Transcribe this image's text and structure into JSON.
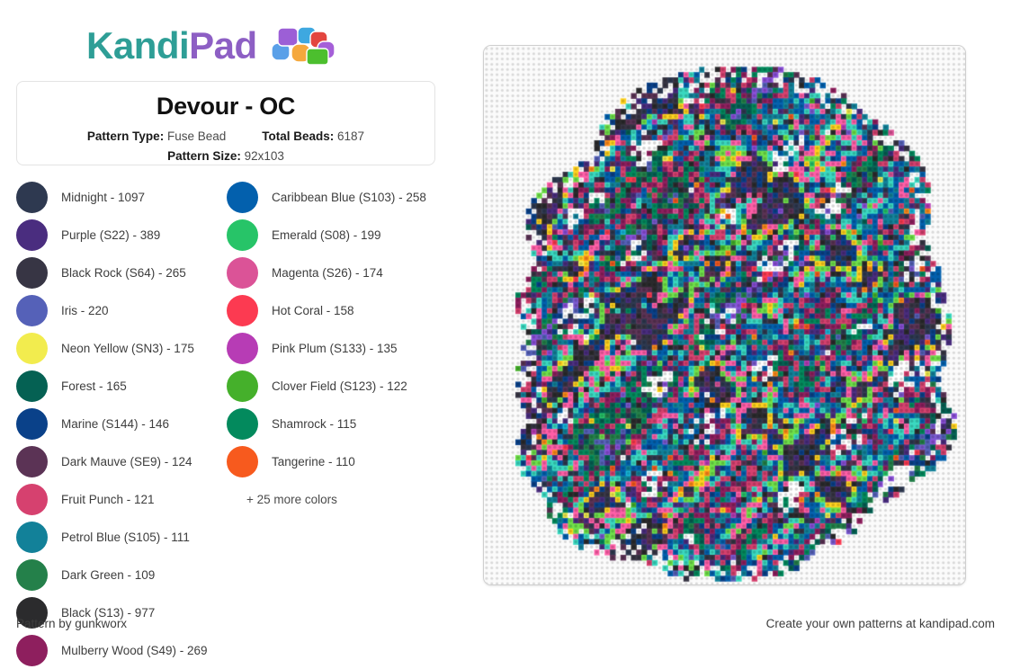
{
  "brand": {
    "name_part1": "Kandi",
    "name_part2": "Pad",
    "color_teal": "#2E9E96",
    "color_purple": "#8D5FC4",
    "bead_icon": "bead-cluster-icon"
  },
  "title_card": {
    "title": "Devour - OC",
    "pattern_type_label": "Pattern Type:",
    "pattern_type_value": "Fuse Bead",
    "total_beads_label": "Total Beads:",
    "total_beads_value": "6187",
    "pattern_size_label": "Pattern Size:",
    "pattern_size_value": "92x103"
  },
  "legend": {
    "more_colors_text": "+ 25 more colors",
    "items": [
      {
        "name": "Midnight - 1097",
        "color": "#2e3950"
      },
      {
        "name": "Purple (S22) - 389",
        "color": "#4a2d7f"
      },
      {
        "name": "Black Rock (S64) - 265",
        "color": "#373544"
      },
      {
        "name": "Iris - 220",
        "color": "#5561b8"
      },
      {
        "name": "Neon Yellow (SN3) - 175",
        "color": "#f2ec4e"
      },
      {
        "name": "Forest - 165",
        "color": "#056153"
      },
      {
        "name": "Marine (S144) - 146",
        "color": "#0a4189"
      },
      {
        "name": "Dark Mauve (SE9) - 124",
        "color": "#5b3355"
      },
      {
        "name": "Fruit Punch - 121",
        "color": "#d6416f"
      },
      {
        "name": "Petrol Blue (S105) - 111",
        "color": "#128199"
      },
      {
        "name": "Dark Green - 109",
        "color": "#24804a"
      },
      {
        "name": "Black (S13) - 977",
        "color": "#2b2b2d"
      },
      {
        "name": "Mulberry Wood (S49) - 269",
        "color": "#8e1f5e"
      },
      {
        "name": "Caribbean Blue (S103) - 258",
        "color": "#0360ad"
      },
      {
        "name": "Emerald (S08) - 199",
        "color": "#27c468"
      },
      {
        "name": "Magenta (S26) - 174",
        "color": "#db5397"
      },
      {
        "name": "Hot Coral - 158",
        "color": "#fc3a51"
      },
      {
        "name": "Pink Plum (S133) - 135",
        "color": "#b73cb5"
      },
      {
        "name": "Clover Field (S123) - 122",
        "color": "#45b02b"
      },
      {
        "name": "Shamrock - 115",
        "color": "#038a5d"
      },
      {
        "name": "Tangerine - 110",
        "color": "#f75a1e"
      }
    ]
  },
  "board": {
    "grid_cols": 92,
    "grid_rows": 103,
    "peg_color": "#d8d8d8",
    "board_background": "#fbfbfb",
    "palette": [
      "#2e3950",
      "#4a2d7f",
      "#373544",
      "#5561b8",
      "#f2ec4e",
      "#056153",
      "#0a4189",
      "#5b3355",
      "#d6416f",
      "#128199",
      "#24804a",
      "#2b2b2d",
      "#8e1f5e",
      "#0360ad",
      "#27c468",
      "#db5397",
      "#fc3a51",
      "#b73cb5",
      "#45b02b",
      "#038a5d",
      "#f75a1e",
      "#ffffff",
      "#17b6d8",
      "#8a4fd8",
      "#ff8c1a",
      "#ffd21e",
      "#6fe04a",
      "#ff5fa8",
      "#3ad8c0",
      "#7b5ad0"
    ]
  },
  "footer": {
    "left_text": "Pattern by gunkworx",
    "right_text": "Create your own patterns at kandipad.com"
  }
}
